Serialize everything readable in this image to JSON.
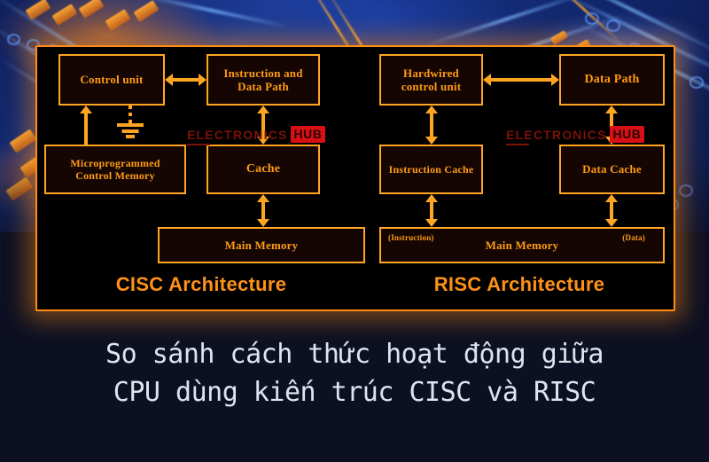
{
  "background": {
    "type": "circuit-board-photo",
    "colors": {
      "blue": "#16307e",
      "orange": "#ff8c14",
      "page_bg": "#0d1022"
    }
  },
  "diagram": {
    "panel_bg": "#000000",
    "accent": "#ffa522",
    "box_fill": "#150604",
    "cisc": {
      "title": "CISC Architecture",
      "nodes": [
        {
          "id": "control-unit",
          "label": "Control unit"
        },
        {
          "id": "instruction-and-data-path",
          "label_line1": "Instruction and",
          "label_line2": "Data Path"
        },
        {
          "id": "microprogrammed-control-memory",
          "label_line1": "Microprogrammed",
          "label_line2": "Control Memory"
        },
        {
          "id": "cache",
          "label": "Cache"
        },
        {
          "id": "main-memory",
          "label": "Main Memory"
        }
      ]
    },
    "risc": {
      "title": "RISC Architecture",
      "nodes": [
        {
          "id": "hardwired-control-unit",
          "label_line1": "Hardwired",
          "label_line2": "control unit"
        },
        {
          "id": "data-path",
          "label": "Data Path"
        },
        {
          "id": "instruction-cache",
          "label": "Instruction Cache"
        },
        {
          "id": "data-cache",
          "label": "Data Cache"
        },
        {
          "id": "main-memory",
          "label": "Main Memory",
          "left_tag": "(Instruction)",
          "right_tag": "(Data)"
        }
      ]
    }
  },
  "watermark": {
    "text": "ELECTRONICS",
    "badge": "HUB",
    "text_color": "#7a1208",
    "badge_color": "#d81016"
  },
  "caption": {
    "line1": "So sánh cách thức hoạt động giữa",
    "line2": "CPU dùng kiến trúc CISC và RISC",
    "color": "#dfe3ee"
  }
}
